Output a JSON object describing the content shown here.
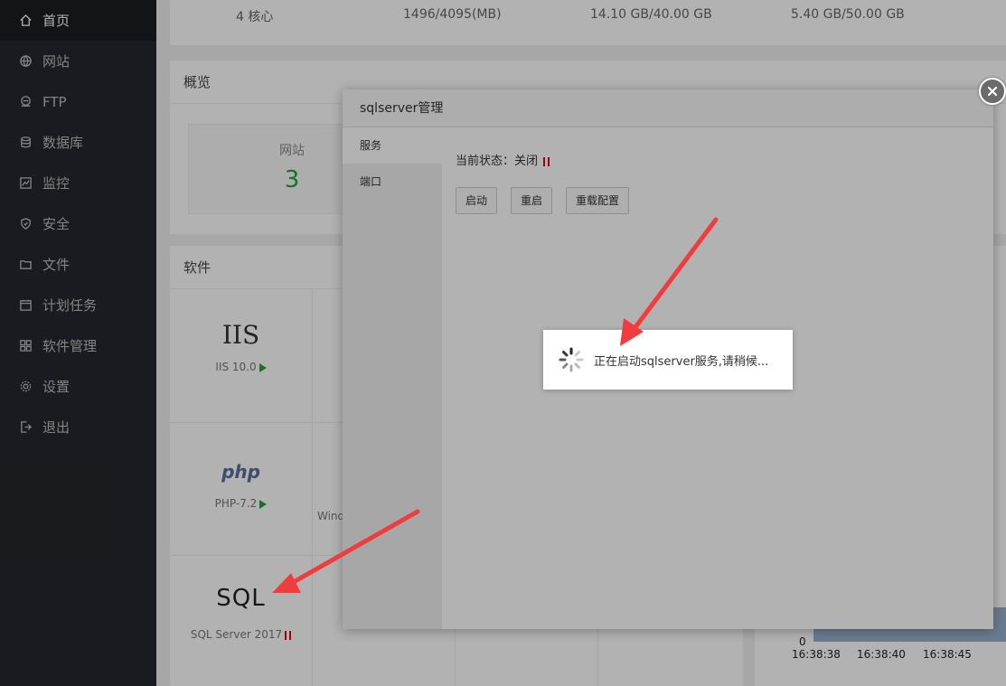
{
  "sidebar": {
    "items": [
      {
        "label": "首页",
        "icon": "home-icon"
      },
      {
        "label": "网站",
        "icon": "globe-icon"
      },
      {
        "label": "FTP",
        "icon": "ftp-icon"
      },
      {
        "label": "数据库",
        "icon": "database-icon"
      },
      {
        "label": "监控",
        "icon": "monitor-icon"
      },
      {
        "label": "安全",
        "icon": "shield-icon"
      },
      {
        "label": "文件",
        "icon": "folder-icon"
      },
      {
        "label": "计划任务",
        "icon": "calendar-icon"
      },
      {
        "label": "软件管理",
        "icon": "grid-icon"
      },
      {
        "label": "设置",
        "icon": "gear-icon"
      },
      {
        "label": "退出",
        "icon": "logout-icon"
      }
    ]
  },
  "topbar": {
    "cpu": "4 核心",
    "memory": "1496/4095(MB)",
    "disk1": "14.10 GB/40.00 GB",
    "disk2": "5.40 GB/50.00 GB"
  },
  "overview": {
    "title": "概览",
    "site_label": "网站",
    "site_count": "3"
  },
  "software": {
    "title": "软件",
    "items": [
      {
        "logo": "IIS",
        "name": "IIS 10.0",
        "status": "running"
      },
      {
        "logo": "php",
        "name": "PHP-7.2",
        "status": "running"
      },
      {
        "logo": "SQL",
        "name": "SQL Server 2017",
        "status": "stopped"
      }
    ],
    "partial_label": "Wind"
  },
  "chart": {
    "y_zero": "0",
    "x_ticks": [
      "16:38:38",
      "16:38:40",
      "16:38:45"
    ]
  },
  "modal": {
    "title": "sqlserver管理",
    "tabs": [
      "服务",
      "端口"
    ],
    "status_label": "当前状态：",
    "status_value": "关闭",
    "buttons": {
      "start": "启动",
      "restart": "重启",
      "reload": "重载配置"
    }
  },
  "toast": {
    "message": "正在启动sqlserver服务,请稍候..."
  },
  "colors": {
    "accent": "#20a53a",
    "stopped": "#e00000",
    "sidebar_bg": "#23282d"
  }
}
